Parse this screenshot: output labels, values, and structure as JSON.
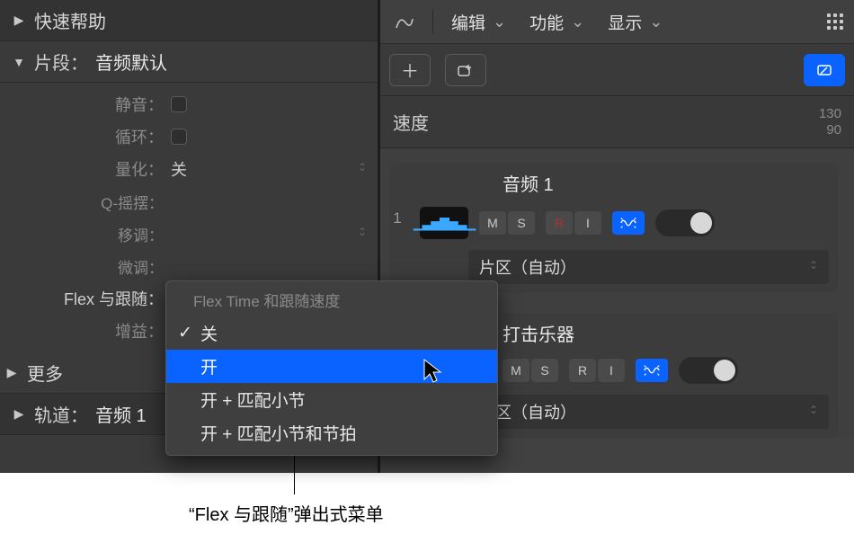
{
  "left": {
    "quickHelp": "快速帮助",
    "regionHeader": {
      "label": "片段：",
      "value": "音频默认"
    },
    "params": {
      "mute": "静音：",
      "loop": "循环：",
      "quantize": {
        "label": "量化：",
        "value": "关"
      },
      "qswing": "Q-摇摆：",
      "transpose": "移调：",
      "finetune": "微调：",
      "flexFollow": "Flex 与跟随：",
      "gain": "增益："
    },
    "more": "更多",
    "trackHeader": {
      "label": "轨道：",
      "value": "音频 1"
    }
  },
  "popup": {
    "title": "Flex Time 和跟随速度",
    "items": [
      {
        "label": "关",
        "checked": true,
        "highlight": false
      },
      {
        "label": "开",
        "checked": false,
        "highlight": true
      },
      {
        "label": "开 + 匹配小节",
        "checked": false,
        "highlight": false
      },
      {
        "label": "开 + 匹配小节和节拍",
        "checked": false,
        "highlight": false
      }
    ]
  },
  "toolbar": {
    "edit": "编辑",
    "func": "功能",
    "view": "显示"
  },
  "tempo": {
    "label": "速度",
    "top": "130",
    "bot": "90"
  },
  "tracks": [
    {
      "num": "1",
      "name": "音频 1",
      "region": "片区（自动）",
      "ms": [
        "M",
        "S"
      ],
      "ri": [
        "R",
        "I"
      ],
      "thumb": true
    },
    {
      "num": "",
      "name": "打击乐器",
      "region": "片区（自动）",
      "ms": [
        "M",
        "S"
      ],
      "ri": [
        "R",
        "I"
      ],
      "thumb": false
    }
  ],
  "callout": "“Flex 与跟随”弹出式菜单"
}
